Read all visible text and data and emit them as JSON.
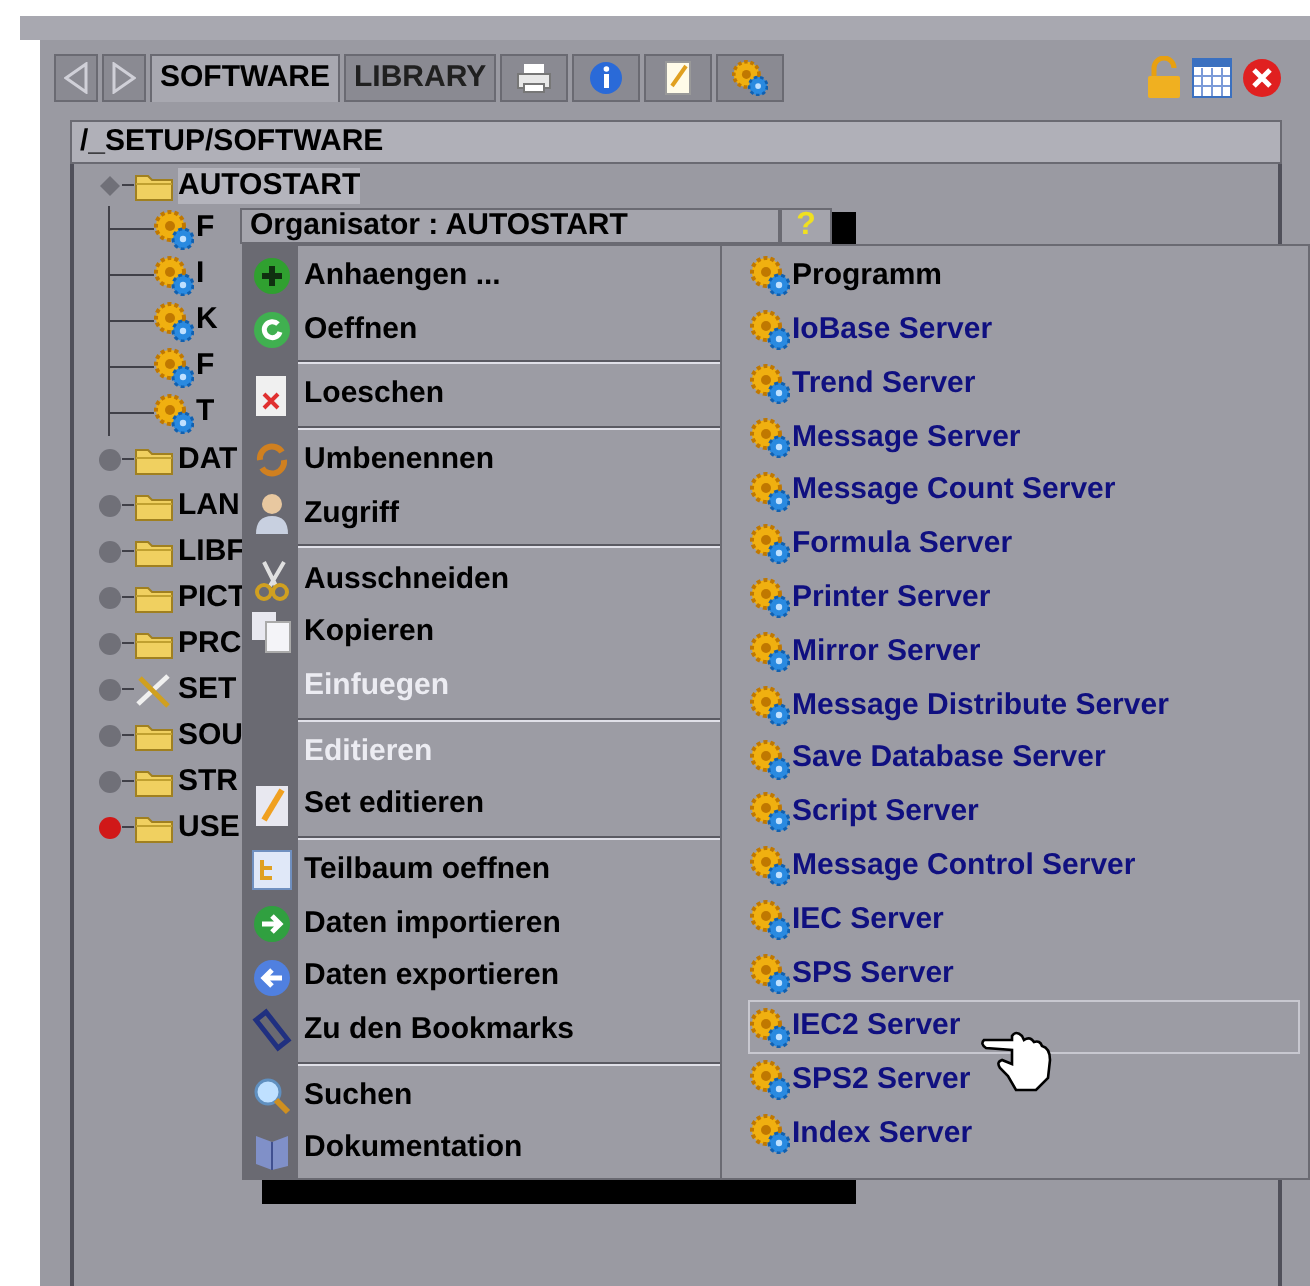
{
  "tabs": [
    {
      "label": "SOFTWARE",
      "selected": true
    },
    {
      "label": "LIBRARY",
      "selected": false
    }
  ],
  "path": "/_SETUP/SOFTWARE",
  "tree": [
    {
      "label": "AUTOSTART",
      "expanded": true,
      "selected": true,
      "color": "#707078",
      "children": [
        {
          "label": "F"
        },
        {
          "label": "I"
        },
        {
          "label": "K"
        },
        {
          "label": "F"
        },
        {
          "label": "T"
        }
      ]
    },
    {
      "label": "DAT",
      "color": "#707078",
      "expanded": false,
      "selected": false
    },
    {
      "label": "LAN",
      "color": "#707078",
      "expanded": false,
      "selected": false
    },
    {
      "label": "LIBF",
      "color": "#707078",
      "expanded": false,
      "selected": false
    },
    {
      "label": "PICT",
      "color": "#707078",
      "expanded": false,
      "selected": false
    },
    {
      "label": "PRC",
      "color": "#707078",
      "expanded": false,
      "selected": false
    },
    {
      "label": "SET",
      "color": "#707078",
      "expanded": false,
      "selected": false
    },
    {
      "label": "SOU",
      "color": "#707078",
      "expanded": false,
      "selected": false
    },
    {
      "label": "STR",
      "color": "#707078",
      "expanded": false,
      "selected": false
    },
    {
      "label": "USE",
      "color": "#d01818",
      "expanded": false,
      "selected": false
    }
  ],
  "menu_title": "Organisator : AUTOSTART",
  "help_button": "?",
  "menu": [
    [
      {
        "label": "Anhaengen ...",
        "disabled": false
      },
      {
        "label": "Oeffnen",
        "disabled": false
      }
    ],
    [
      {
        "label": "Loeschen",
        "disabled": false
      }
    ],
    [
      {
        "label": "Umbenennen",
        "disabled": false
      },
      {
        "label": "Zugriff",
        "disabled": false
      }
    ],
    [
      {
        "label": "Ausschneiden",
        "disabled": false
      },
      {
        "label": "Kopieren",
        "disabled": false
      },
      {
        "label": "Einfuegen",
        "disabled": true
      }
    ],
    [
      {
        "label": "Editieren",
        "disabled": true
      },
      {
        "label": "Set editieren",
        "disabled": false
      }
    ],
    [
      {
        "label": "Teilbaum oeffnen",
        "disabled": false
      },
      {
        "label": "Daten importieren",
        "disabled": false
      },
      {
        "label": "Daten exportieren",
        "disabled": false
      },
      {
        "label": "Zu den Bookmarks",
        "disabled": false
      }
    ],
    [
      {
        "label": "Suchen",
        "disabled": false
      },
      {
        "label": "Dokumentation",
        "disabled": false
      }
    ]
  ],
  "submenu": [
    {
      "label": "Programm",
      "kind": "program",
      "selected": false
    },
    {
      "label": "IoBase Server",
      "kind": "server",
      "selected": false
    },
    {
      "label": "Trend Server",
      "kind": "server",
      "selected": false
    },
    {
      "label": "Message Server",
      "kind": "server",
      "selected": false
    },
    {
      "label": "Message Count Server",
      "kind": "server",
      "selected": false
    },
    {
      "label": "Formula Server",
      "kind": "server",
      "selected": false
    },
    {
      "label": "Printer Server",
      "kind": "server",
      "selected": false
    },
    {
      "label": "Mirror Server",
      "kind": "server",
      "selected": false
    },
    {
      "label": "Message Distribute Server",
      "kind": "server",
      "selected": false
    },
    {
      "label": "Save Database Server",
      "kind": "server",
      "selected": false
    },
    {
      "label": "Script Server",
      "kind": "server",
      "selected": false
    },
    {
      "label": "Message Control Server",
      "kind": "server",
      "selected": false
    },
    {
      "label": "IEC Server",
      "kind": "server",
      "selected": false
    },
    {
      "label": "SPS Server",
      "kind": "server",
      "selected": false
    },
    {
      "label": "IEC2 Server",
      "kind": "server",
      "selected": true
    },
    {
      "label": "SPS2 Server",
      "kind": "server",
      "selected": false
    },
    {
      "label": "Index Server",
      "kind": "server",
      "selected": false
    }
  ]
}
